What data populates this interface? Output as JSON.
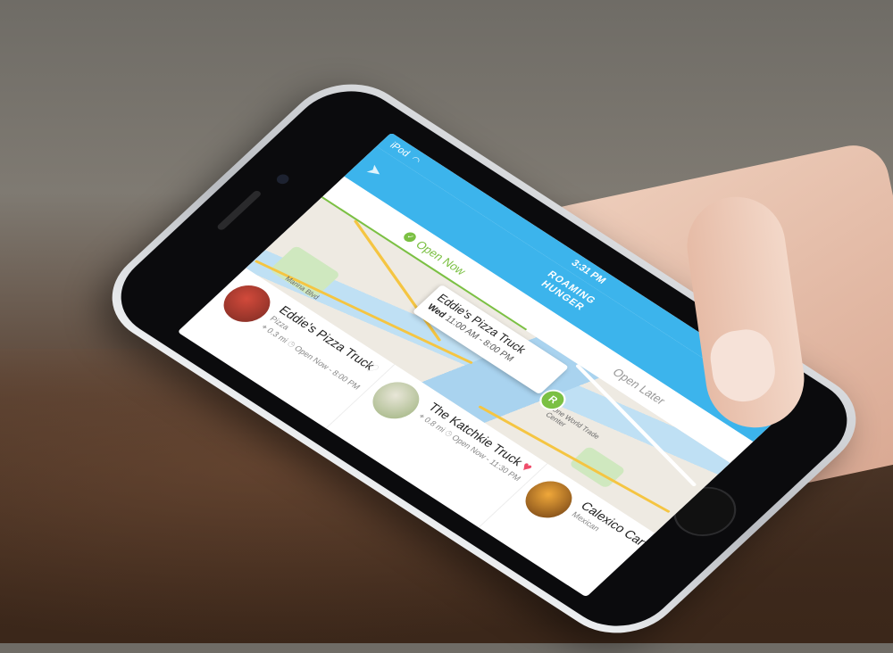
{
  "status_bar": {
    "carrier": "iPod",
    "time": "3:31 PM"
  },
  "header": {
    "logo_line1": "ROAMING",
    "logo_line2": "HUNGER"
  },
  "tabs": [
    {
      "label": "Open Now",
      "active": true
    },
    {
      "label": "Open Later",
      "active": false
    }
  ],
  "map": {
    "labels": [
      "Marina Blvd",
      "One World Trade Center"
    ],
    "pin_glyph": "R",
    "callout": {
      "name": "Eddie's Pizza Truck",
      "day": "Wed",
      "hours": "11:00 AM - 8:00 PM"
    }
  },
  "list": [
    {
      "name": "Eddie's Pizza Truck",
      "type": "Pizza",
      "distance": "0.3 mi",
      "hours": "Open Now - 8:00 PM",
      "favorited": false
    },
    {
      "name": "The Katchkie Truck",
      "type": "",
      "distance": "0.8 mi",
      "hours": "Open Now - 11:30 PM",
      "favorited": true
    },
    {
      "name": "Calexico Cart",
      "type": "Mexican",
      "distance": "",
      "hours": "",
      "favorited": false
    }
  ],
  "colors": {
    "brand_blue": "#3cb4ec",
    "accent_green": "#7bc043",
    "heart_red": "#ef4d6b"
  },
  "icons": {
    "location": "location-arrow-icon",
    "favorite": "heart-icon",
    "distance": "map-pin-icon",
    "hours": "clock-icon"
  }
}
